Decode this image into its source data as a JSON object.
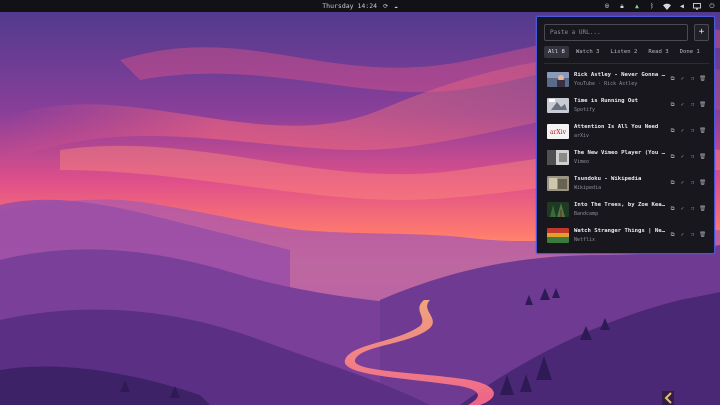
{
  "topbar": {
    "datetime": "Thursday 14:24",
    "center_icons": [
      "sync-icon",
      "cloud-icon"
    ],
    "tray_icons": [
      "user-lock-icon",
      "lock-icon",
      "network-up-icon",
      "bluetooth-icon",
      "wifi-icon",
      "volume-icon",
      "display-icon",
      "power-icon"
    ]
  },
  "panel": {
    "url_placeholder": "Paste a URL...",
    "add_label": "+",
    "tabs": [
      {
        "label": "All 8",
        "active": true
      },
      {
        "label": "Watch 3",
        "active": false
      },
      {
        "label": "Listen 2",
        "active": false
      },
      {
        "label": "Read 3",
        "active": false
      },
      {
        "label": "Done 1",
        "active": false
      }
    ],
    "items": [
      {
        "title": "Rick Astley - Never Gonna Give You Up",
        "subtitle": "YouTube · Rick Astley",
        "thumb": "video-thumb"
      },
      {
        "title": "Time is Running Out",
        "subtitle": "Spotify",
        "thumb": "music-thumb"
      },
      {
        "title": "Attention Is All You Need",
        "subtitle": "arXiv",
        "thumb": "arxiv-thumb"
      },
      {
        "title": "The New Vimeo Player (You Know, For Videos)",
        "subtitle": "Vimeo",
        "thumb": "vimeo-thumb"
      },
      {
        "title": "Tsundoku - Wikipedia",
        "subtitle": "Wikipedia",
        "thumb": "wiki-thumb"
      },
      {
        "title": "Into The Trees, by Zoe Keating",
        "subtitle": "Bandcamp",
        "thumb": "forest-thumb"
      },
      {
        "title": "Watch Stranger Things | Netflix",
        "subtitle": "Netflix",
        "thumb": "netflix-thumb"
      }
    ],
    "action_icons": [
      "open-external-icon",
      "check-icon",
      "copy-icon",
      "delete-icon"
    ]
  },
  "colors": {
    "panel_bg": "#17171d",
    "panel_border": "#4a57d8",
    "topbar_bg": "#111116",
    "sky_top": "#5a3a8a",
    "sky_glow": "#ff6a6a",
    "horizon": "#ffb07a"
  }
}
